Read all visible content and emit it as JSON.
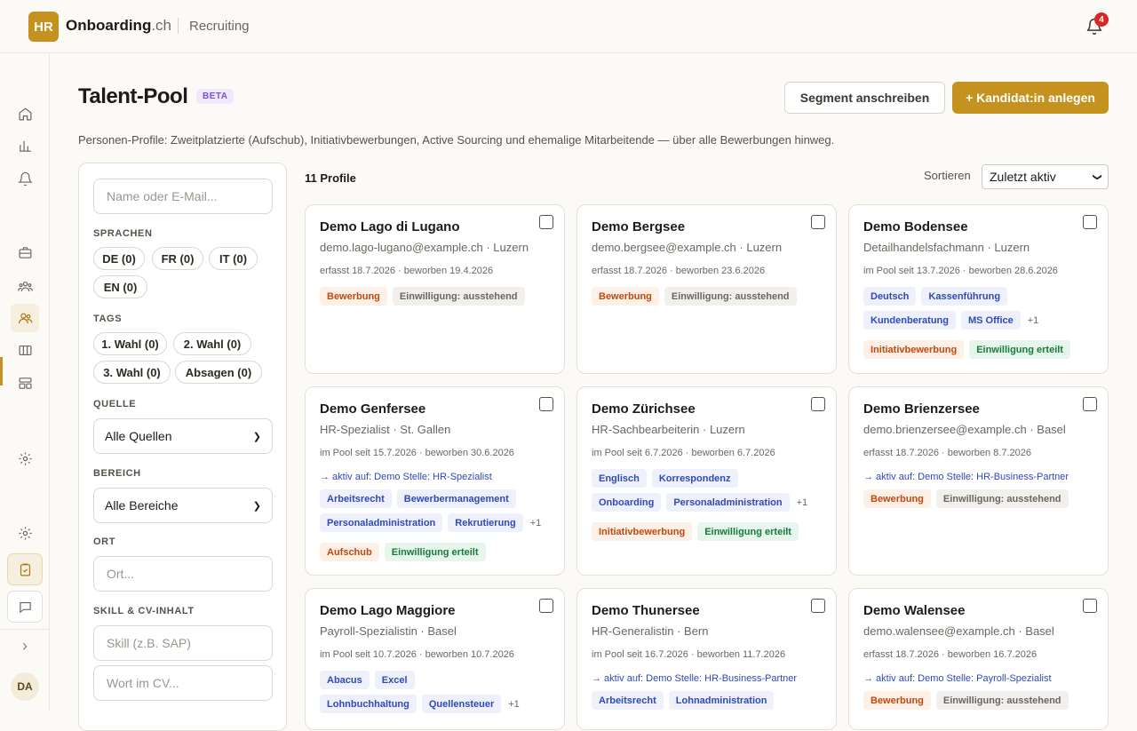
{
  "topbar": {
    "logo": "HR",
    "brand_main": "Onboarding",
    "brand_tld": ".ch",
    "module": "Recruiting",
    "notification_count": "4"
  },
  "sidebar": {
    "avatar": "DA",
    "collapse_icon": "›"
  },
  "header": {
    "title": "Talent-Pool",
    "badge": "BETA",
    "segment_button": "Segment anschreiben",
    "add_button": "+ Kandidat:in anlegen",
    "subtitle": "Personen-Profile: Zweitplatzierte (Aufschub), Initiativbewerbungen, Active Sourcing und ehemalige Mitarbeitende — über alle Bewerbungen hinweg."
  },
  "filters": {
    "search_placeholder": "Name oder E-Mail...",
    "languages_label": "SPRACHEN",
    "languages": [
      "DE (0)",
      "FR (0)",
      "IT (0)",
      "EN (0)"
    ],
    "tags_label": "TAGS",
    "tags": [
      "1. Wahl (0)",
      "2. Wahl (0)",
      "3. Wahl (0)",
      "Absagen (0)"
    ],
    "source_label": "QUELLE",
    "source_value": "Alle Quellen",
    "area_label": "BEREICH",
    "area_value": "Alle Bereiche",
    "location_label": "ORT",
    "location_placeholder": "Ort...",
    "skill_label": "SKILL & CV-INHALT",
    "skill_placeholder": "Skill (z.B. SAP)",
    "cv_placeholder": "Wort im CV..."
  },
  "list": {
    "count": "11 Profile",
    "sort_label": "Sortieren",
    "sort_value": "Zuletzt aktiv"
  },
  "cards": [
    {
      "name": "Demo Lago di Lugano",
      "info": "demo.lago-lugano@example.ch · Luzern",
      "meta": "erfasst 18.7.2026 · beworben 19.4.2026",
      "active": "",
      "skills": [],
      "skills_more": "",
      "status": [
        {
          "label": "Bewerbung",
          "tone": "orange"
        },
        {
          "label": "Einwilligung: ausstehend",
          "tone": "gray"
        }
      ]
    },
    {
      "name": "Demo Bergsee",
      "info": "demo.bergsee@example.ch · Luzern",
      "meta": "erfasst 18.7.2026 · beworben 23.6.2026",
      "active": "",
      "skills": [],
      "skills_more": "",
      "status": [
        {
          "label": "Bewerbung",
          "tone": "orange"
        },
        {
          "label": "Einwilligung: ausstehend",
          "tone": "gray"
        }
      ]
    },
    {
      "name": "Demo Bodensee",
      "info": "Detailhandelsfachmann · Luzern",
      "meta": "im Pool seit 13.7.2026 · beworben 28.6.2026",
      "active": "",
      "skills": [
        "Deutsch",
        "Kassenführung",
        "Kundenberatung",
        "MS Office"
      ],
      "skills_more": "+1",
      "status": [
        {
          "label": "Initiativbewerbung",
          "tone": "orange"
        },
        {
          "label": "Einwilligung erteilt",
          "tone": "green"
        }
      ]
    },
    {
      "name": "Demo Genfersee",
      "info": "HR-Spezialist · St. Gallen",
      "meta": "im Pool seit 15.7.2026 · beworben 30.6.2026",
      "active": "→ aktiv auf: Demo Stelle: HR-Spezialist",
      "skills": [
        "Arbeitsrecht",
        "Bewerbermanagement",
        "Personaladministration",
        "Rekrutierung"
      ],
      "skills_more": "+1",
      "status": [
        {
          "label": "Aufschub",
          "tone": "orange"
        },
        {
          "label": "Einwilligung erteilt",
          "tone": "green"
        }
      ]
    },
    {
      "name": "Demo Zürichsee",
      "info": "HR-Sachbearbeiterin · Luzern",
      "meta": "im Pool seit 6.7.2026 · beworben 6.7.2026",
      "active": "",
      "skills": [
        "Englisch",
        "Korrespondenz",
        "Onboarding",
        "Personaladministration"
      ],
      "skills_more": "+1",
      "status": [
        {
          "label": "Initiativbewerbung",
          "tone": "orange"
        },
        {
          "label": "Einwilligung erteilt",
          "tone": "green"
        }
      ]
    },
    {
      "name": "Demo Brienzersee",
      "info": "demo.brienzersee@example.ch · Basel",
      "meta": "erfasst 18.7.2026 · beworben 8.7.2026",
      "active": "→ aktiv auf: Demo Stelle: HR-Business-Partner",
      "skills": [],
      "skills_more": "",
      "status": [
        {
          "label": "Bewerbung",
          "tone": "orange"
        },
        {
          "label": "Einwilligung: ausstehend",
          "tone": "gray"
        }
      ]
    },
    {
      "name": "Demo Lago Maggiore",
      "info": "Payroll-Spezialistin · Basel",
      "meta": "im Pool seit 10.7.2026 · beworben 10.7.2026",
      "active": "",
      "skills": [
        "Abacus",
        "Excel",
        "Lohnbuchhaltung",
        "Quellensteuer"
      ],
      "skills_more": "+1",
      "status": []
    },
    {
      "name": "Demo Thunersee",
      "info": "HR-Generalistin · Bern",
      "meta": "im Pool seit 16.7.2026 · beworben 11.7.2026",
      "active": "→ aktiv auf: Demo Stelle: HR-Business-Partner",
      "skills": [
        "Arbeitsrecht",
        "Lohnadministration"
      ],
      "skills_more": "",
      "status": []
    },
    {
      "name": "Demo Walensee",
      "info": "demo.walensee@example.ch · Basel",
      "meta": "erfasst 18.7.2026 · beworben 16.7.2026",
      "active": "→ aktiv auf: Demo Stelle: Payroll-Spezialist",
      "skills": [],
      "skills_more": "",
      "status": [
        {
          "label": "Bewerbung",
          "tone": "orange"
        },
        {
          "label": "Einwilligung: ausstehend",
          "tone": "gray"
        }
      ]
    }
  ]
}
